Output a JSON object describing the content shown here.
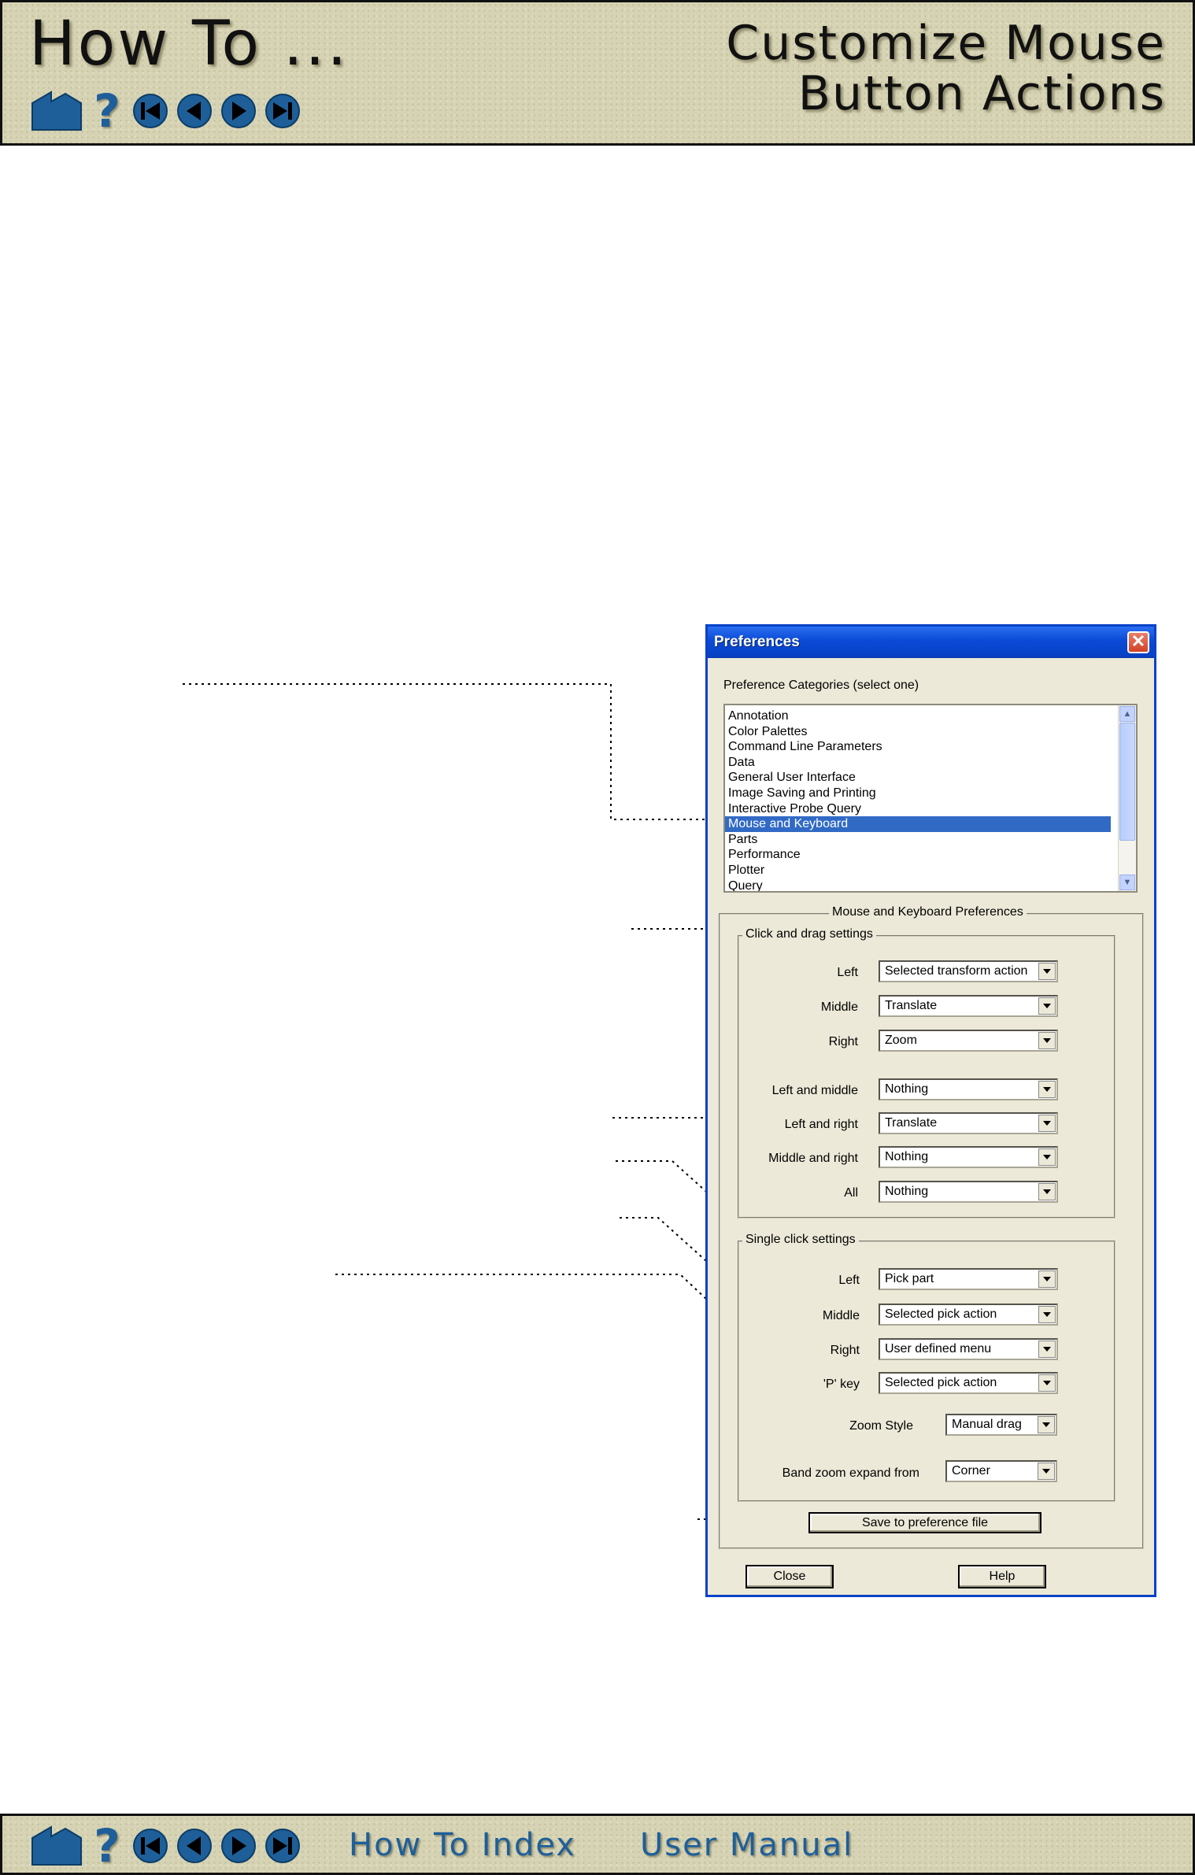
{
  "header": {
    "title": "How To ...",
    "subtitle_line1": "Customize Mouse",
    "subtitle_line2": "Button Actions"
  },
  "nav": {
    "help_glyph": "?",
    "icons": [
      "home-icon",
      "help-icon",
      "first-page-icon",
      "previous-page-icon",
      "next-page-icon",
      "last-page-icon"
    ]
  },
  "footer": {
    "how_to_index": "How To Index",
    "user_manual": "User Manual"
  },
  "dialog": {
    "title": "Preferences",
    "close_glyph": "✕",
    "categories_label": "Preference Categories (select one)",
    "categories": [
      "Annotation",
      "Color Palettes",
      "Command Line Parameters",
      "Data",
      "General User Interface",
      "Image Saving and Printing",
      "Interactive Probe Query",
      "Mouse and Keyboard",
      "Parts",
      "Performance",
      "Plotter",
      "Query"
    ],
    "selected_category": "Mouse and Keyboard",
    "section_title": "Mouse and Keyboard Preferences",
    "click_drag": {
      "legend": "Click and drag settings",
      "rows": [
        {
          "label": "Left",
          "value": "Selected transform action"
        },
        {
          "label": "Middle",
          "value": "Translate"
        },
        {
          "label": "Right",
          "value": "Zoom"
        },
        {
          "label": "Left and middle",
          "value": "Nothing"
        },
        {
          "label": "Left and right",
          "value": "Translate"
        },
        {
          "label": "Middle and right",
          "value": "Nothing"
        },
        {
          "label": "All",
          "value": "Nothing"
        }
      ]
    },
    "single_click": {
      "legend": "Single click settings",
      "rows": [
        {
          "label": "Left",
          "value": "Pick part"
        },
        {
          "label": "Middle",
          "value": "Selected pick action"
        },
        {
          "label": "Right",
          "value": "User defined menu"
        },
        {
          "label": "'P' key",
          "value": "Selected pick action"
        }
      ],
      "zoom_style_label": "Zoom Style",
      "zoom_style_value": "Manual drag",
      "band_zoom_label": "Band zoom expand from",
      "band_zoom_value": "Corner"
    },
    "save_button": "Save to preference file",
    "close_button": "Close",
    "help_button": "Help"
  },
  "colors": {
    "band": "#d6d3b4",
    "nav_blue": "#1e5f99",
    "dialog_bg": "#ece9d8",
    "titlebar": "#0a4ad6",
    "selection": "#316ac5"
  }
}
